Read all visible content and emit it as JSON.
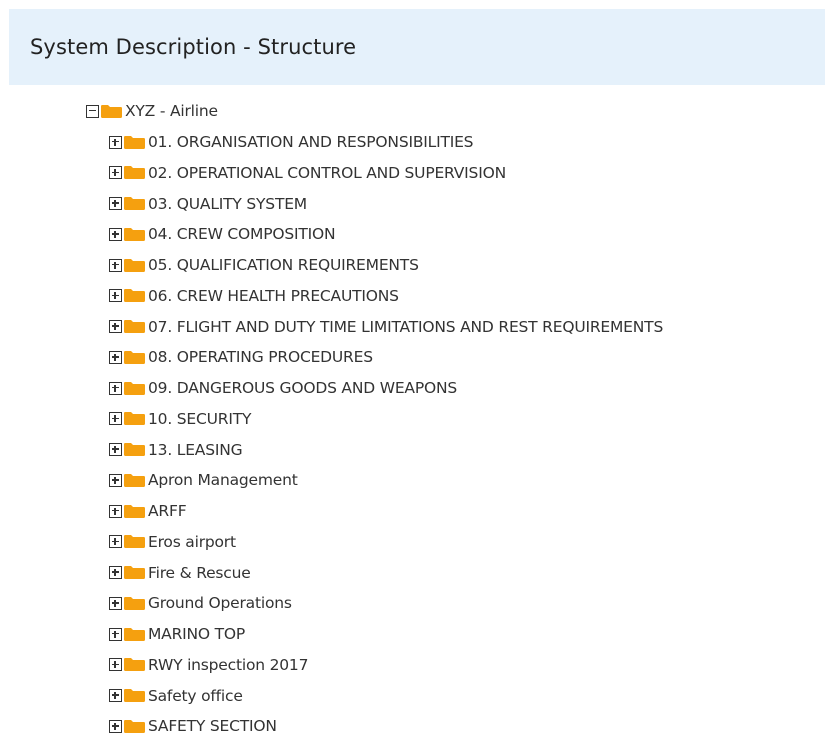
{
  "header": {
    "title": "System Description - Structure"
  },
  "colors": {
    "header_bg": "#e5f1fb",
    "folder": "#f5a00f"
  },
  "tree": {
    "root": {
      "label": "XYZ - Airline",
      "state": "expanded",
      "icon": "folder-icon"
    },
    "children": [
      {
        "label": "01. ORGANISATION AND RESPONSIBILITIES",
        "state": "collapsed"
      },
      {
        "label": "02. OPERATIONAL CONTROL AND SUPERVISION",
        "state": "collapsed"
      },
      {
        "label": "03. QUALITY SYSTEM",
        "state": "collapsed"
      },
      {
        "label": "04. CREW COMPOSITION",
        "state": "collapsed"
      },
      {
        "label": "05. QUALIFICATION REQUIREMENTS",
        "state": "collapsed"
      },
      {
        "label": "06. CREW HEALTH PRECAUTIONS",
        "state": "collapsed"
      },
      {
        "label": "07. FLIGHT AND DUTY TIME LIMITATIONS AND REST REQUIREMENTS",
        "state": "collapsed"
      },
      {
        "label": "08. OPERATING PROCEDURES",
        "state": "collapsed"
      },
      {
        "label": "09. DANGEROUS GOODS AND WEAPONS",
        "state": "collapsed"
      },
      {
        "label": "10. SECURITY",
        "state": "collapsed"
      },
      {
        "label": "13. LEASING",
        "state": "collapsed"
      },
      {
        "label": "Apron Management",
        "state": "collapsed"
      },
      {
        "label": "ARFF",
        "state": "collapsed"
      },
      {
        "label": "Eros airport",
        "state": "collapsed"
      },
      {
        "label": "Fire & Rescue",
        "state": "collapsed"
      },
      {
        "label": "Ground Operations",
        "state": "collapsed"
      },
      {
        "label": "MARINO TOP",
        "state": "collapsed"
      },
      {
        "label": "RWY inspection 2017",
        "state": "collapsed"
      },
      {
        "label": "Safety office",
        "state": "collapsed"
      },
      {
        "label": "SAFETY SECTION",
        "state": "collapsed"
      }
    ]
  }
}
